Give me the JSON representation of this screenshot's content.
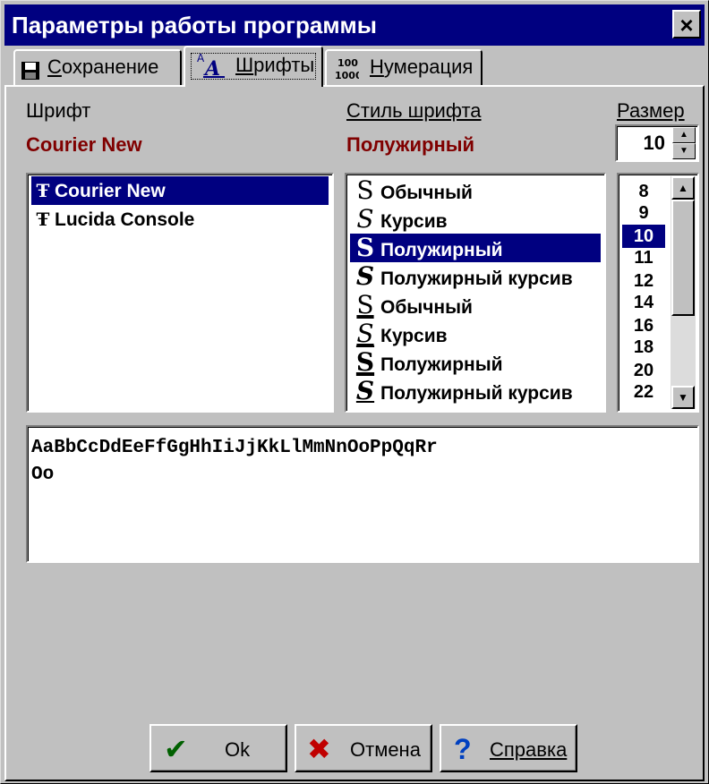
{
  "window": {
    "title": "Параметры работы программы",
    "close": "×"
  },
  "tabs": [
    {
      "pre": "",
      "ul": "С",
      "post": "охранение",
      "icon": "save-icon"
    },
    {
      "pre": "",
      "ul": "Ш",
      "post": "рифты",
      "icon": "font-icon"
    },
    {
      "pre": "",
      "ul": "Н",
      "post": "умерация",
      "icon": "numbering-icon"
    }
  ],
  "font": {
    "label": "Шрифт",
    "current": "Courier New",
    "items": [
      "Courier New",
      "Lucida Console"
    ],
    "selected": 0
  },
  "style": {
    "label": "Стиль шрифта",
    "current": "Полужирный",
    "items": [
      "Обычный",
      "Курсив",
      "Полужирный",
      "Полужирный курсив",
      "Обычный",
      "Курсив",
      "Полужирный",
      "Полужирный курсив"
    ],
    "selected": 2
  },
  "size": {
    "label": "Размер",
    "value": "10",
    "items": [
      "8",
      "9",
      "10",
      "11",
      "12",
      "14",
      "16",
      "18",
      "20",
      "22"
    ],
    "selected": 2
  },
  "preview": {
    "line1": "AaBbCcDdEeFfGgHhIiJjKkLlMmNnOoPpQqRr",
    "line2": "Oo"
  },
  "buttons": {
    "ok": "Ok",
    "cancel": "Отмена",
    "help": "Справка"
  },
  "icons": {
    "font_type": "Ŧ",
    "style_glyph": "S",
    "save": "save-icon",
    "check": "✔",
    "cross": "✖",
    "question": "?"
  },
  "colors": {
    "titlebar": "#000080",
    "selection": "#000080",
    "accent_label": "#800000",
    "check": "#006000",
    "cross": "#c00000",
    "question": "#0040c0"
  }
}
